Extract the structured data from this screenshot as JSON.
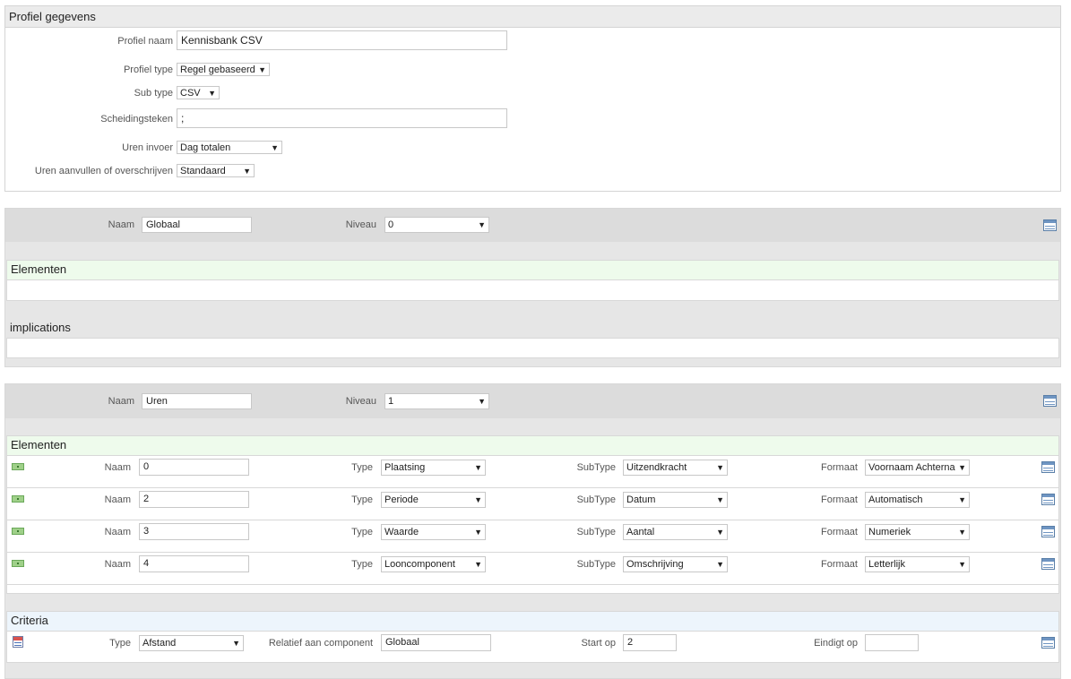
{
  "profile": {
    "title": "Profiel gegevens",
    "fields": {
      "name_label": "Profiel naam",
      "name_value": "Kennisbank CSV",
      "type_label": "Profiel type",
      "type_value": "Regel gebaseerd",
      "subtype_label": "Sub type",
      "subtype_value": "CSV",
      "separator_label": "Scheidingsteken",
      "separator_value": ";",
      "hours_input_label": "Uren invoer",
      "hours_input_value": "Dag totalen",
      "hours_mode_label": "Uren aanvullen of overschrijven",
      "hours_mode_value": "Standaard"
    }
  },
  "groups": [
    {
      "name_label": "Naam",
      "name_value": "Globaal",
      "level_label": "Niveau",
      "level_value": "0",
      "elements_title": "Elementen",
      "implications_title": "implications"
    },
    {
      "name_label": "Naam",
      "name_value": "Uren",
      "level_label": "Niveau",
      "level_value": "1",
      "elements_title": "Elementen",
      "element_rows": [
        {
          "naam_label": "Naam",
          "naam": "0",
          "type_label": "Type",
          "type": "Plaatsing",
          "subtype_label": "SubType",
          "subtype": "Uitzendkracht",
          "format_label": "Formaat",
          "format": "Voornaam Achterna"
        },
        {
          "naam_label": "Naam",
          "naam": "2",
          "type_label": "Type",
          "type": "Periode",
          "subtype_label": "SubType",
          "subtype": "Datum",
          "format_label": "Formaat",
          "format": "Automatisch"
        },
        {
          "naam_label": "Naam",
          "naam": "3",
          "type_label": "Type",
          "type": "Waarde",
          "subtype_label": "SubType",
          "subtype": "Aantal",
          "format_label": "Formaat",
          "format": "Numeriek"
        },
        {
          "naam_label": "Naam",
          "naam": "4",
          "type_label": "Type",
          "type": "Looncomponent",
          "subtype_label": "SubType",
          "subtype": "Omschrijving",
          "format_label": "Formaat",
          "format": "Letterlijk"
        }
      ],
      "criteria_title": "Criteria",
      "criteria": {
        "type_label": "Type",
        "type_value": "Afstand",
        "relative_label": "Relatief aan component",
        "relative_value": "Globaal",
        "start_label": "Start op",
        "start_value": "2",
        "end_label": "Eindigt op",
        "end_value": ""
      }
    }
  ],
  "colors": {
    "elements_header": "#eefbec",
    "criteria_header": "#edf5fc",
    "panel_gray": "#e6e6e6"
  },
  "icons": [
    "table-icon",
    "money-icon",
    "criteria-icon",
    "dropdown-arrow-icon"
  ]
}
